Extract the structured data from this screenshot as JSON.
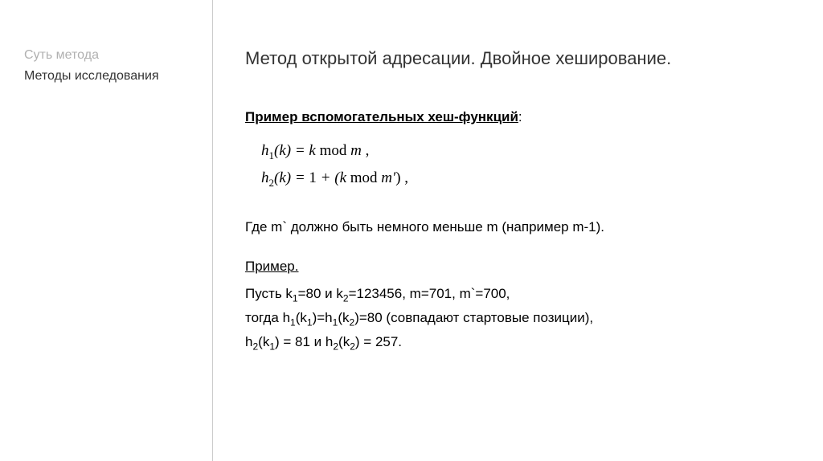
{
  "sidebar": {
    "items": [
      {
        "label": "Суть метода",
        "active": false
      },
      {
        "label": "Методы исследования",
        "active": true
      }
    ]
  },
  "content": {
    "title": "Метод открытой адресации. Двойное хеширование.",
    "section_header": "Пример вспомогательных хеш-функций",
    "colon": ":",
    "formula1_lhs_h": "h",
    "formula1_lhs_sub": "1",
    "formula1_lhs_k": "(k) = k",
    "formula1_mod": " mod ",
    "formula1_m": "m",
    "formula1_end": " ,",
    "formula2_lhs_h": "h",
    "formula2_lhs_sub": "2",
    "formula2_body": "(k) = ",
    "formula2_one": "1",
    "formula2_plus": " + (k",
    "formula2_mod": " mod ",
    "formula2_m": "m′",
    "formula2_end": ") ,",
    "note": "Где m` должно быть немного меньше m (например m-1).",
    "example_label": "Пример.",
    "example_line1_pre": "Пусть k",
    "example_line1_sub1": "1",
    "example_line1_mid1": "=80 и k",
    "example_line1_sub2": "2",
    "example_line1_post": "=123456, m=701, m`=700,",
    "example_line2_pre": "тогда h",
    "example_line2_sub1": "1",
    "example_line2_mid1": "(k",
    "example_line2_sub2": "1",
    "example_line2_mid2": ")=h",
    "example_line2_sub3": "1",
    "example_line2_mid3": "(k",
    "example_line2_sub4": "2",
    "example_line2_post": ")=80 (совпадают стартовые позиции),",
    "example_line3_pre": "h",
    "example_line3_sub1": "2",
    "example_line3_mid1": "(k",
    "example_line3_sub2": "1",
    "example_line3_mid2": ") = 81 и h",
    "example_line3_sub3": "2",
    "example_line3_mid3": "(k",
    "example_line3_sub4": "2",
    "example_line3_post": ") = 257."
  }
}
